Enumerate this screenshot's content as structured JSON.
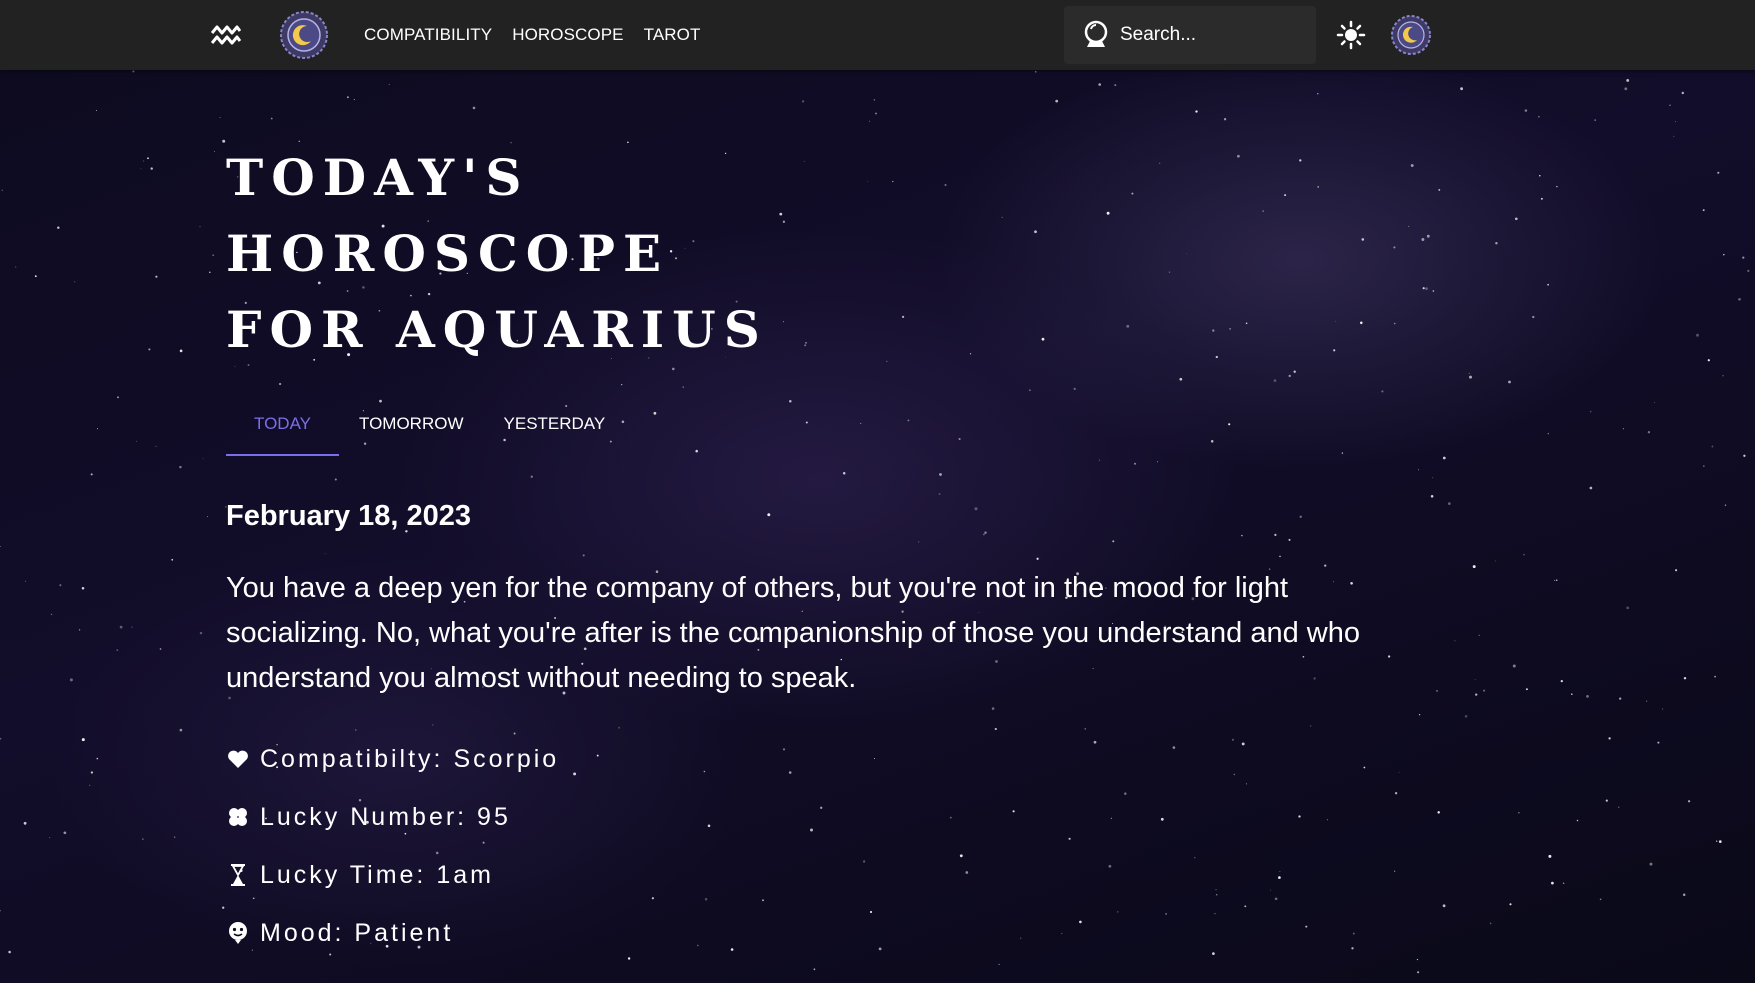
{
  "nav": {
    "brand_icon": "aquarius-symbol-icon",
    "logo_icon": "moon-seal-logo-icon",
    "links": [
      {
        "label": "COMPATIBILITY"
      },
      {
        "label": "HOROSCOPE"
      },
      {
        "label": "TAROT"
      }
    ],
    "search": {
      "icon": "crystal-ball-icon",
      "placeholder": "Search..."
    },
    "theme_icon": "sun-icon",
    "avatar_icon": "moon-avatar-icon"
  },
  "main": {
    "title_lines": [
      "TODAY'S",
      "HOROSCOPE",
      "FOR AQUARIUS"
    ],
    "tabs": [
      {
        "label": "TODAY",
        "active": true
      },
      {
        "label": "TOMORROW",
        "active": false
      },
      {
        "label": "YESTERDAY",
        "active": false
      }
    ],
    "date": "February 18, 2023",
    "reading": "You have a deep yen for the company of others, but you're not in the mood for light socializing. No, what you're after is the companionship of those you understand and who understand you almost without needing to speak.",
    "facts": [
      {
        "icon": "heart-icon",
        "text": "Compatibilty: Scorpio"
      },
      {
        "icon": "clover-icon",
        "text": "Lucky Number: 95"
      },
      {
        "icon": "hourglass-icon",
        "text": "Lucky Time: 1am"
      },
      {
        "icon": "mood-face-icon",
        "text": "Mood: Patient"
      }
    ]
  },
  "colors": {
    "accent": "#7b6ee8",
    "navbar": "#222222",
    "background": "#0c0a1c"
  }
}
